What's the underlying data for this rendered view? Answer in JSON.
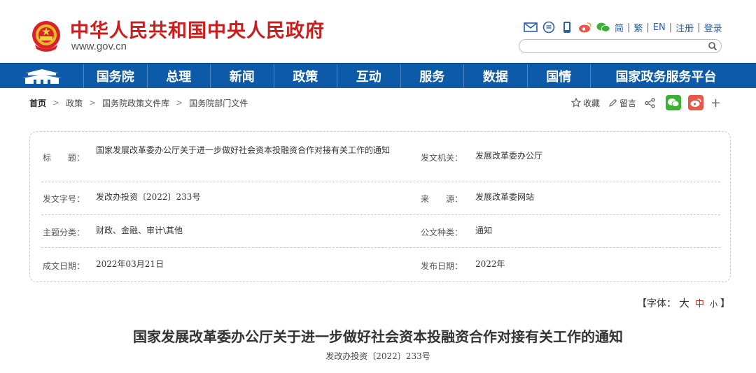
{
  "header": {
    "site_name": "中华人民共和国中央人民政府",
    "site_url": "www.gov.cn",
    "top_links": [
      "简",
      "繁",
      "EN",
      "注册",
      "登录"
    ],
    "search_placeholder": ""
  },
  "nav": {
    "items": [
      "国务院",
      "总理",
      "新闻",
      "政策",
      "互动",
      "服务",
      "数据",
      "国情",
      "国家政务服务平台"
    ]
  },
  "breadcrumb": [
    "首页",
    "政策",
    "国务院政策文件库",
    "国务院部门文件"
  ],
  "share": {
    "favorite": "收藏",
    "comment": "留言",
    "plus": "+"
  },
  "info": {
    "title_label": "标　　题：",
    "title_value": "国家发展改革委办公厅关于进一步做好社会资本投融资合作对接有关工作的通知",
    "issuer_label": "发文机关：",
    "issuer_value": "发展改革委办公厅",
    "doc_no_label": "发文字号：",
    "doc_no_value": "发改办投资〔2022〕233号",
    "source_label": "来　　源：",
    "source_value": "发展改革委网站",
    "category_label": "主题分类：",
    "category_value": "财政、金融、审计\\其他",
    "type_label": "公文种类：",
    "type_value": "通知",
    "written_label": "成文日期：",
    "written_value": "2022年03月21日",
    "publish_label": "发布日期：",
    "publish_value": "2022年"
  },
  "font_size": {
    "open": "【字体：",
    "large": "大",
    "medium": "中",
    "small": "小",
    "close": "】"
  },
  "document": {
    "title": "国家发展改革委办公厅关于进一步做好社会资本投融资合作对接有关工作的通知",
    "number": "发改办投资〔2022〕233号"
  },
  "colors": {
    "brand_red": "#c81e1e",
    "nav_blue": "#0d5aa8",
    "link_blue": "#2a5ea8",
    "wechat_green": "#3cb034",
    "weibo_red": "#e8574a"
  }
}
